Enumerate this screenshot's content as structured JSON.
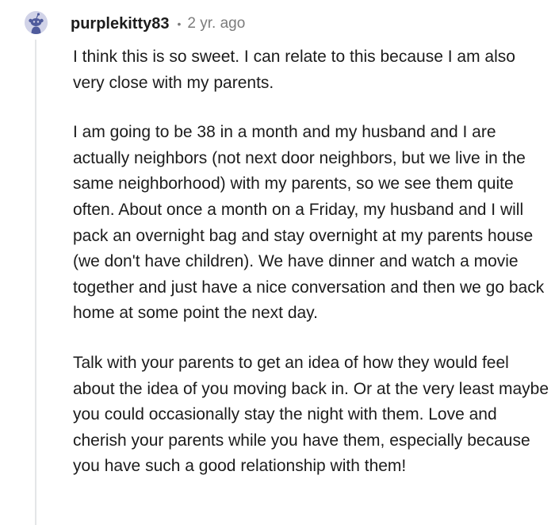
{
  "comment": {
    "username": "purplekitty83",
    "separator": "•",
    "timestamp": "2 yr. ago",
    "avatar_icon": "snoo-avatar-icon",
    "paragraphs": [
      "I think this is so sweet. I can relate to this because I am also very close with my parents.",
      "I am going to be 38 in a month and my husband and I are actually neighbors (not next door neighbors, but we live in the same neighborhood) with my parents, so we see them quite often. About once a month on a Friday, my husband and I will pack an overnight bag and stay overnight at my parents house (we don't have children). We have dinner and watch a movie together and just have a nice conversation and then we go back home at some point the next day.",
      "Talk with your parents to get an idea of how they would feel about the idea of you moving back in. Or at the very least maybe you could occasionally stay the night with them. Love and cherish your parents while you have them, especially because you have such a good relationship with them!"
    ]
  },
  "colors": {
    "text": "#1c1c1c",
    "meta": "#7c7c7c",
    "avatar_bg": "#d1d3e8",
    "avatar_figure": "#4f5b9c",
    "thread_line": "#e4e6e8"
  }
}
